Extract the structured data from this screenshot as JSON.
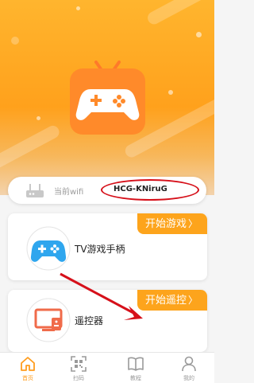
{
  "wifi": {
    "label": "当前wifi",
    "ssid": "HCG-KNiruG"
  },
  "cards": [
    {
      "button": "开始游戏",
      "title": "TV游戏手柄",
      "icon": "gamepad-icon"
    },
    {
      "button": "开始遥控",
      "title": "遥控器",
      "icon": "remote-tv-icon"
    }
  ],
  "tabs": [
    {
      "label": "首页",
      "icon": "home-icon",
      "active": true
    },
    {
      "label": "扫码",
      "icon": "qr-scan-icon",
      "active": false
    },
    {
      "label": "教程",
      "icon": "book-icon",
      "active": false
    },
    {
      "label": "我的",
      "icon": "user-icon",
      "active": false
    }
  ],
  "colors": {
    "accent": "#fda41c",
    "annotation": "#d6101a",
    "gamepad_blue": "#2fa6ee",
    "remote_red": "#f06b4a"
  }
}
